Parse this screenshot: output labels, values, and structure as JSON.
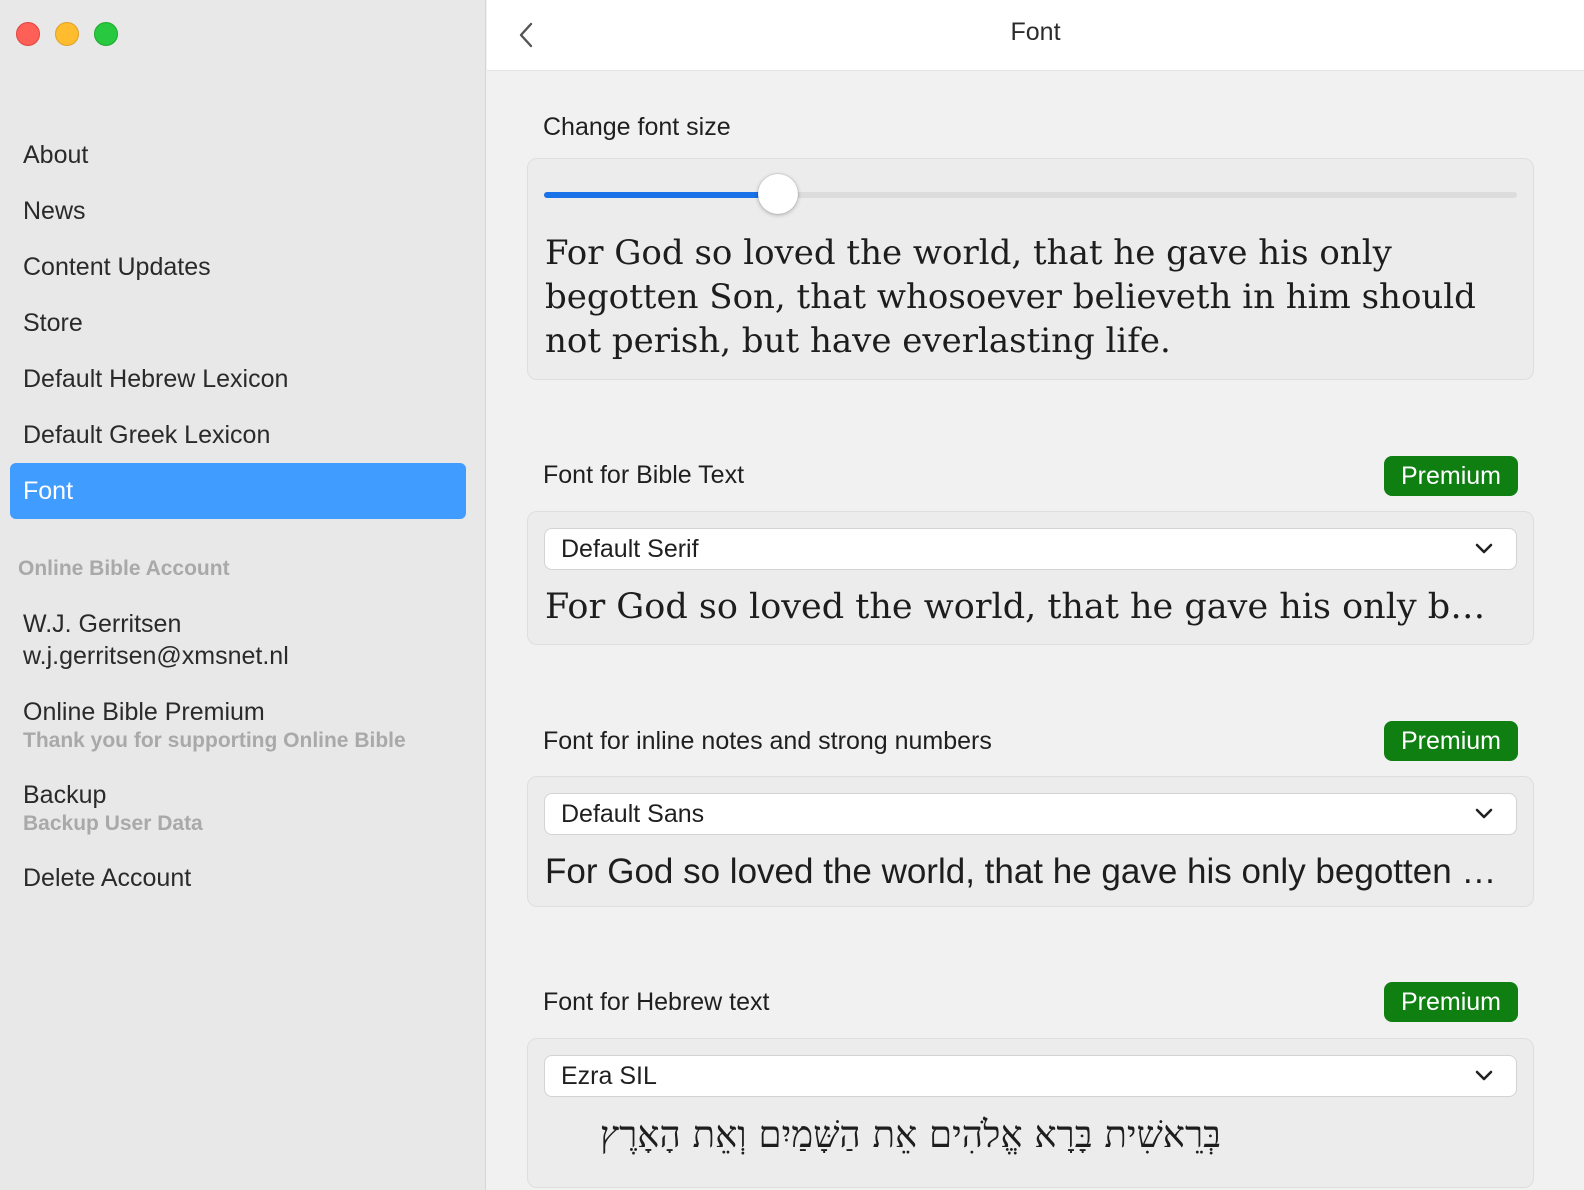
{
  "sidebar": {
    "items": [
      {
        "label": "About"
      },
      {
        "label": "News"
      },
      {
        "label": "Content Updates"
      },
      {
        "label": "Store"
      },
      {
        "label": "Default Hebrew Lexicon"
      },
      {
        "label": "Default Greek Lexicon"
      },
      {
        "label": "Font",
        "selected": true
      }
    ],
    "account_section_header": "Online Bible Account",
    "account": {
      "name": "W.J. Gerritsen",
      "email": "w.j.gerritsen@xmsnet.nl"
    },
    "premium": {
      "title": "Online Bible Premium",
      "subtitle": "Thank you for supporting Online Bible"
    },
    "backup": {
      "title": "Backup",
      "subtitle": "Backup User Data"
    },
    "delete_account": "Delete Account"
  },
  "header": {
    "title": "Font"
  },
  "font_size": {
    "label": "Change font size",
    "slider_value": 0.24,
    "sample_text": "For God so loved the world, that he gave his only begotten Son, that whosoever believeth in him should not perish, but have everlasting life."
  },
  "bible_font": {
    "label": "Font for Bible Text",
    "badge": "Premium",
    "selected": "Default Serif",
    "sample_text": "For God so loved the world, that he gave his only begotten Son, that whosoever believeth in him should not perish, but have everlasting life."
  },
  "notes_font": {
    "label": "Font for inline notes and strong numbers",
    "badge": "Premium",
    "selected": "Default Sans",
    "sample_text": "For God so loved the world, that he gave his only begotten Son, that whosoever believeth in him should not perish, but have everlasting life."
  },
  "hebrew_font": {
    "label": "Font for Hebrew text",
    "badge": "Premium",
    "selected": "Ezra SIL",
    "sample_text": "בְּרֵאשִׁית בָּרָא אֱלֹהִים אֵת הַשָּׁמַיִם וְאֵת הָאָרֶץ"
  },
  "colors": {
    "selection_blue": "#409cff",
    "slider_blue": "#1a72e8",
    "premium_green": "#0f7f12"
  }
}
